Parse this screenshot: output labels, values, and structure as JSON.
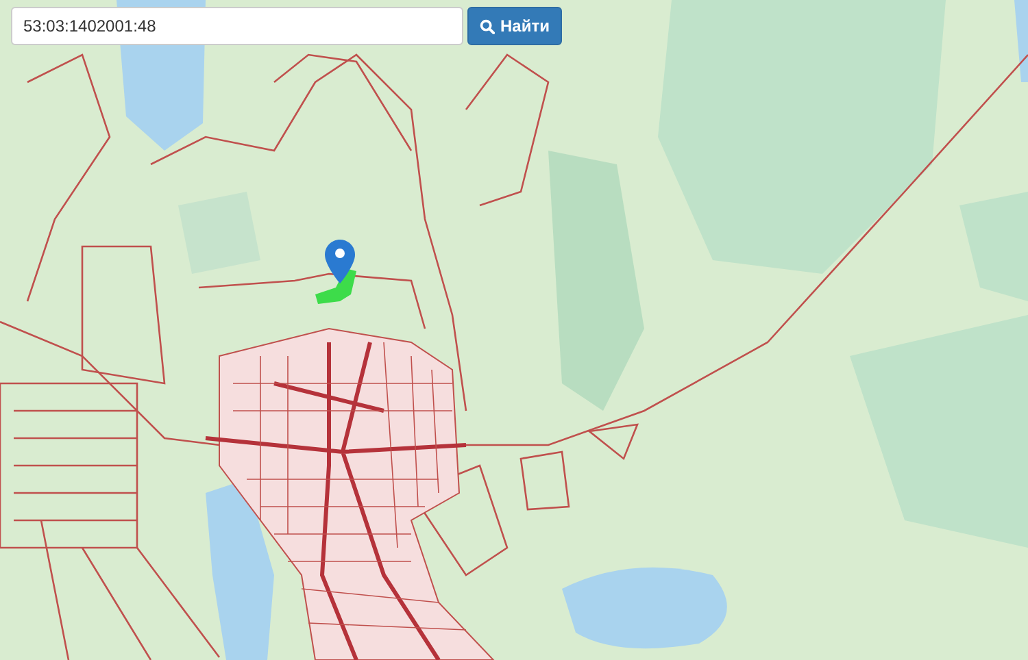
{
  "search": {
    "value": "53:03:1402001:48"
  },
  "search_button": {
    "label": "Найти"
  }
}
